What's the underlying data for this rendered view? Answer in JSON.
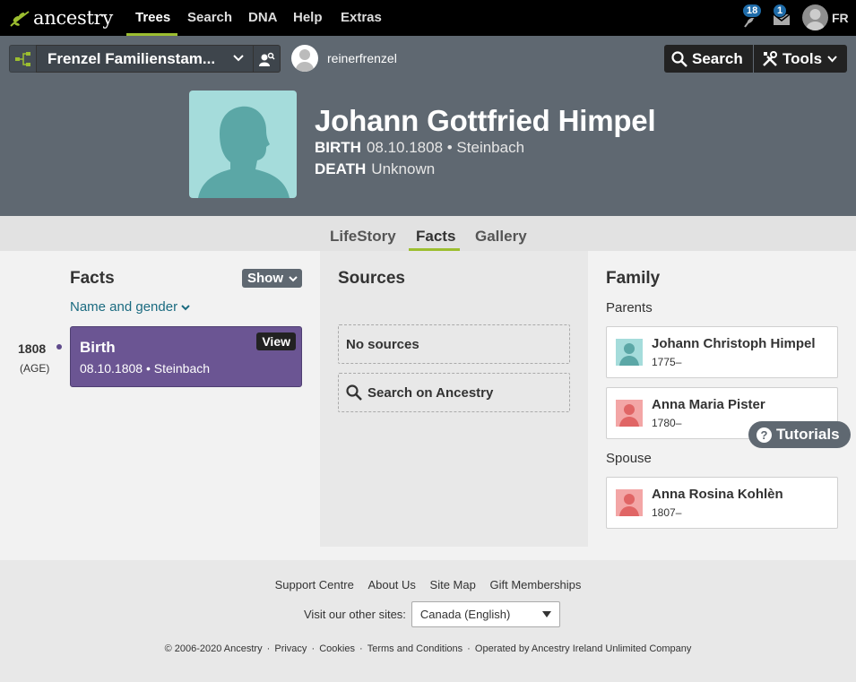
{
  "nav": {
    "logo": "ancestry",
    "items": [
      "Trees",
      "Search",
      "DNA",
      "Help",
      "Extras"
    ],
    "hints_count": "18",
    "messages_count": "1",
    "user_initials": "FR"
  },
  "header": {
    "tree_name": "Frenzel Familienstam...",
    "username": "reinerfrenzel",
    "search_label": "Search",
    "tools_label": "Tools",
    "person_name": "Johann Gottfried Himpel",
    "birth_label": "BIRTH",
    "birth_value": "08.10.1808 • Steinbach",
    "death_label": "DEATH",
    "death_value": "Unknown"
  },
  "tabs": [
    "LifeStory",
    "Facts",
    "Gallery"
  ],
  "facts": {
    "title": "Facts",
    "show_label": "Show",
    "filter_label": "Name and gender",
    "events": [
      {
        "year": "1808",
        "age": "(AGE)",
        "title": "Birth",
        "detail": "08.10.1808 • Steinbach",
        "view_label": "View"
      }
    ]
  },
  "sources": {
    "title": "Sources",
    "empty_label": "No sources",
    "search_label": "Search on Ancestry"
  },
  "family": {
    "title": "Family",
    "parents_label": "Parents",
    "spouse_label": "Spouse",
    "parents": [
      {
        "name": "Johann Christoph Himpel",
        "years": "1775–",
        "gender": "male"
      },
      {
        "name": "Anna Maria Pister",
        "years": "1780–",
        "gender": "female"
      }
    ],
    "spouse": [
      {
        "name": "Anna Rosina Kohlèn",
        "years": "1807–",
        "gender": "female"
      }
    ]
  },
  "tutorials_label": "Tutorials",
  "footer": {
    "links": [
      "Support Centre",
      "About Us",
      "Site Map",
      "Gift Memberships"
    ],
    "other_sites_label": "Visit our other sites:",
    "other_sites_value": "Canada (English)",
    "copyright": [
      "© 2006-2020 Ancestry",
      "Privacy",
      "Cookies",
      "Terms and Conditions",
      "Operated by Ancestry Ireland Unlimited Company"
    ]
  },
  "colors": {
    "nav_bg": "#000000",
    "header_bg": "#5f6871",
    "accent_green": "#9cbe30",
    "fact_purple": "#6b5593",
    "link_teal": "#1b6b80",
    "male_thumb": "#a5dcdb",
    "female_thumb": "#f3a6a6"
  }
}
